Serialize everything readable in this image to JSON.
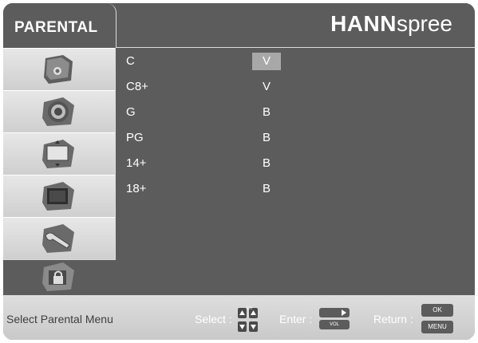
{
  "header": {
    "title": "PARENTAL",
    "brand_bold": "HANN",
    "brand_light": "spree"
  },
  "sidebar": {
    "items": [
      {
        "icon": "picture-icon"
      },
      {
        "icon": "speaker-icon"
      },
      {
        "icon": "screen-icon"
      },
      {
        "icon": "setup-icon"
      },
      {
        "icon": "tools-icon"
      },
      {
        "icon": "parental-lock-icon",
        "active": true
      }
    ]
  },
  "ratings": [
    {
      "label": "C",
      "value": "V",
      "selected": true
    },
    {
      "label": "C8+",
      "value": "V"
    },
    {
      "label": "G",
      "value": "B"
    },
    {
      "label": "PG",
      "value": "B"
    },
    {
      "label": "14+",
      "value": "B"
    },
    {
      "label": "18+",
      "value": "B"
    }
  ],
  "footer": {
    "help": "Select Parental Menu",
    "select_label": "Select :",
    "enter_label": "Enter :",
    "return_label": "Return :",
    "ch_key": "CH",
    "vol_key": "VOL",
    "ok_key": "OK",
    "menu_key": "MENU"
  },
  "colors": {
    "panel": "#5c5c5c",
    "highlight": "#a8a8a8",
    "footer": "#d4d4d4"
  }
}
